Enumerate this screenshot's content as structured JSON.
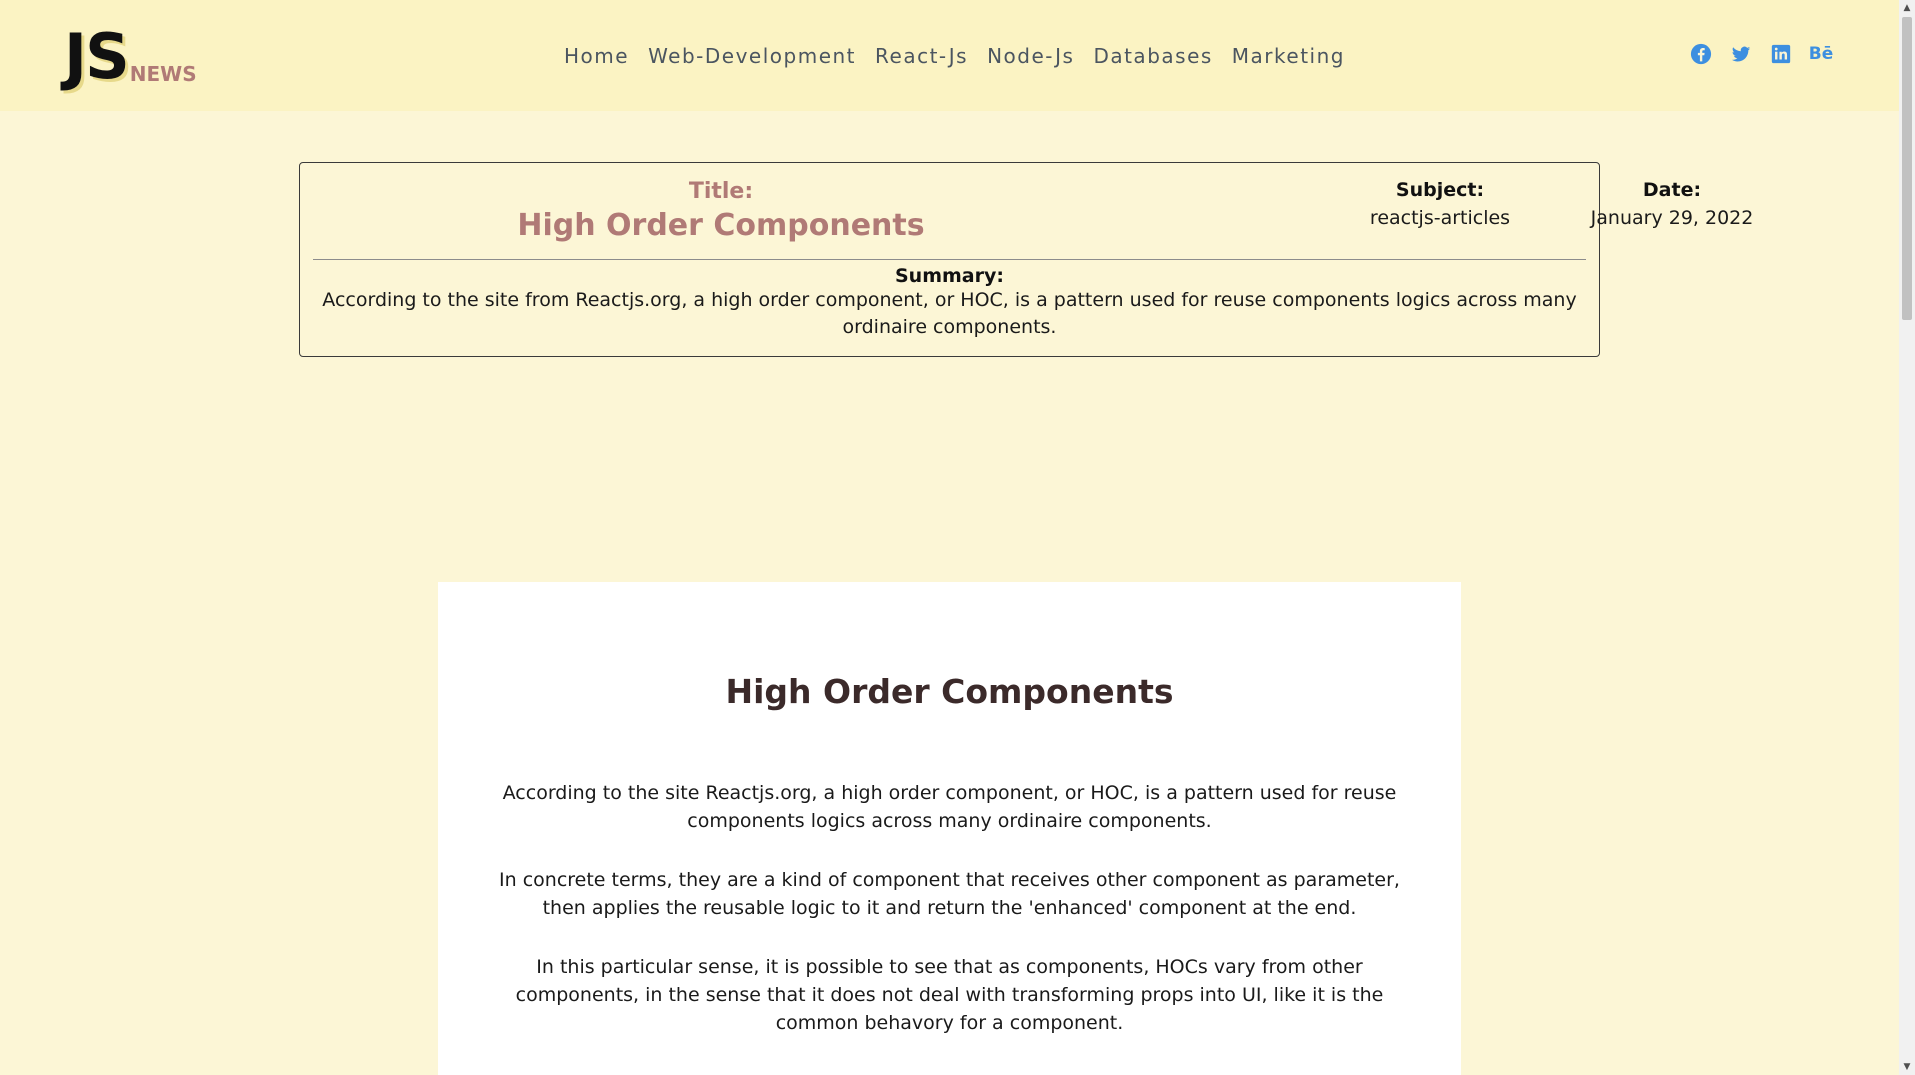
{
  "header": {
    "logo_main": "JS",
    "logo_sub": "NEWS",
    "nav": [
      "Home",
      "Web-Development",
      "React-Js",
      "Node-Js",
      "Databases",
      "Marketing"
    ],
    "socials": [
      "facebook-icon",
      "twitter-icon",
      "linkedin-icon",
      "behance-icon"
    ],
    "behance_glyph": "Bē"
  },
  "card": {
    "title_label": "Title:",
    "title": "High Order Components",
    "subject_label": "Subject:",
    "subject": "reactjs-articles",
    "date_label": "Date:",
    "date": "January 29, 2022",
    "summary_label": "Summary:",
    "summary": "According to the site from Reactjs.org, a high order component, or HOC, is a pattern used for reuse components logics across many ordinaire components."
  },
  "article": {
    "title": "High Order Components",
    "paragraphs": [
      "According to the site Reactjs.org, a high order component, or HOC, is a pattern used for reuse components logics across many ordinaire components.",
      "In concrete terms, they are a kind of component that receives other component as parameter, then applies the reusable logic to it and return the 'enhanced' component at the end.",
      "In this particular sense, it is possible to see that as components, HOCs vary from other components, in the sense that it does not deal with transforming props into UI, like it is the common behavory for a component."
    ]
  },
  "colors": {
    "page_bg": "#fcf6d6",
    "header_bg": "#fbf3c3",
    "accent": "#b07a76",
    "social_blue": "#3d8fe0"
  }
}
